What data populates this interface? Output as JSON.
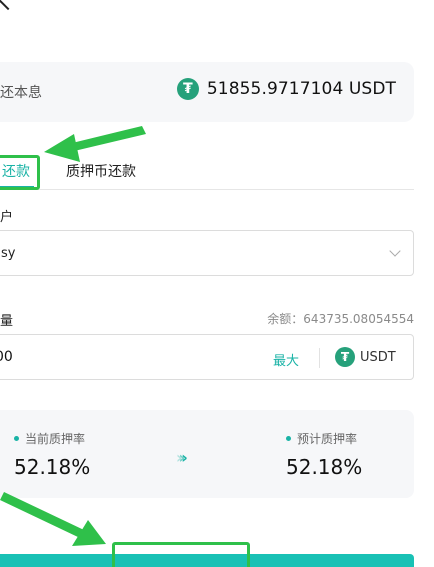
{
  "header": {
    "back_icon": "chevron-left-icon"
  },
  "summary": {
    "label": "还本息",
    "amount": "51855.9717104 USDT",
    "icon": "tether-icon",
    "icon_glyph": "₮"
  },
  "tabs": [
    {
      "label": "还款",
      "active": true
    },
    {
      "label": "质押币还款",
      "active": false
    }
  ],
  "account": {
    "label": "户",
    "selected_value": "sy"
  },
  "amount_field": {
    "label": "量",
    "balance_text": "余额：643735.08054554",
    "input_value": "00",
    "max_label": "最大",
    "unit": "USDT"
  },
  "ratio": {
    "current_label": "当前质押率",
    "current_value": "52.18%",
    "estimated_label": "预计质押率",
    "estimated_value": "52.18%"
  },
  "colors": {
    "accent": "#19b3a6",
    "tether": "#26a17b",
    "annotation": "#2fc04a",
    "card_bg": "#f6f7f9"
  }
}
